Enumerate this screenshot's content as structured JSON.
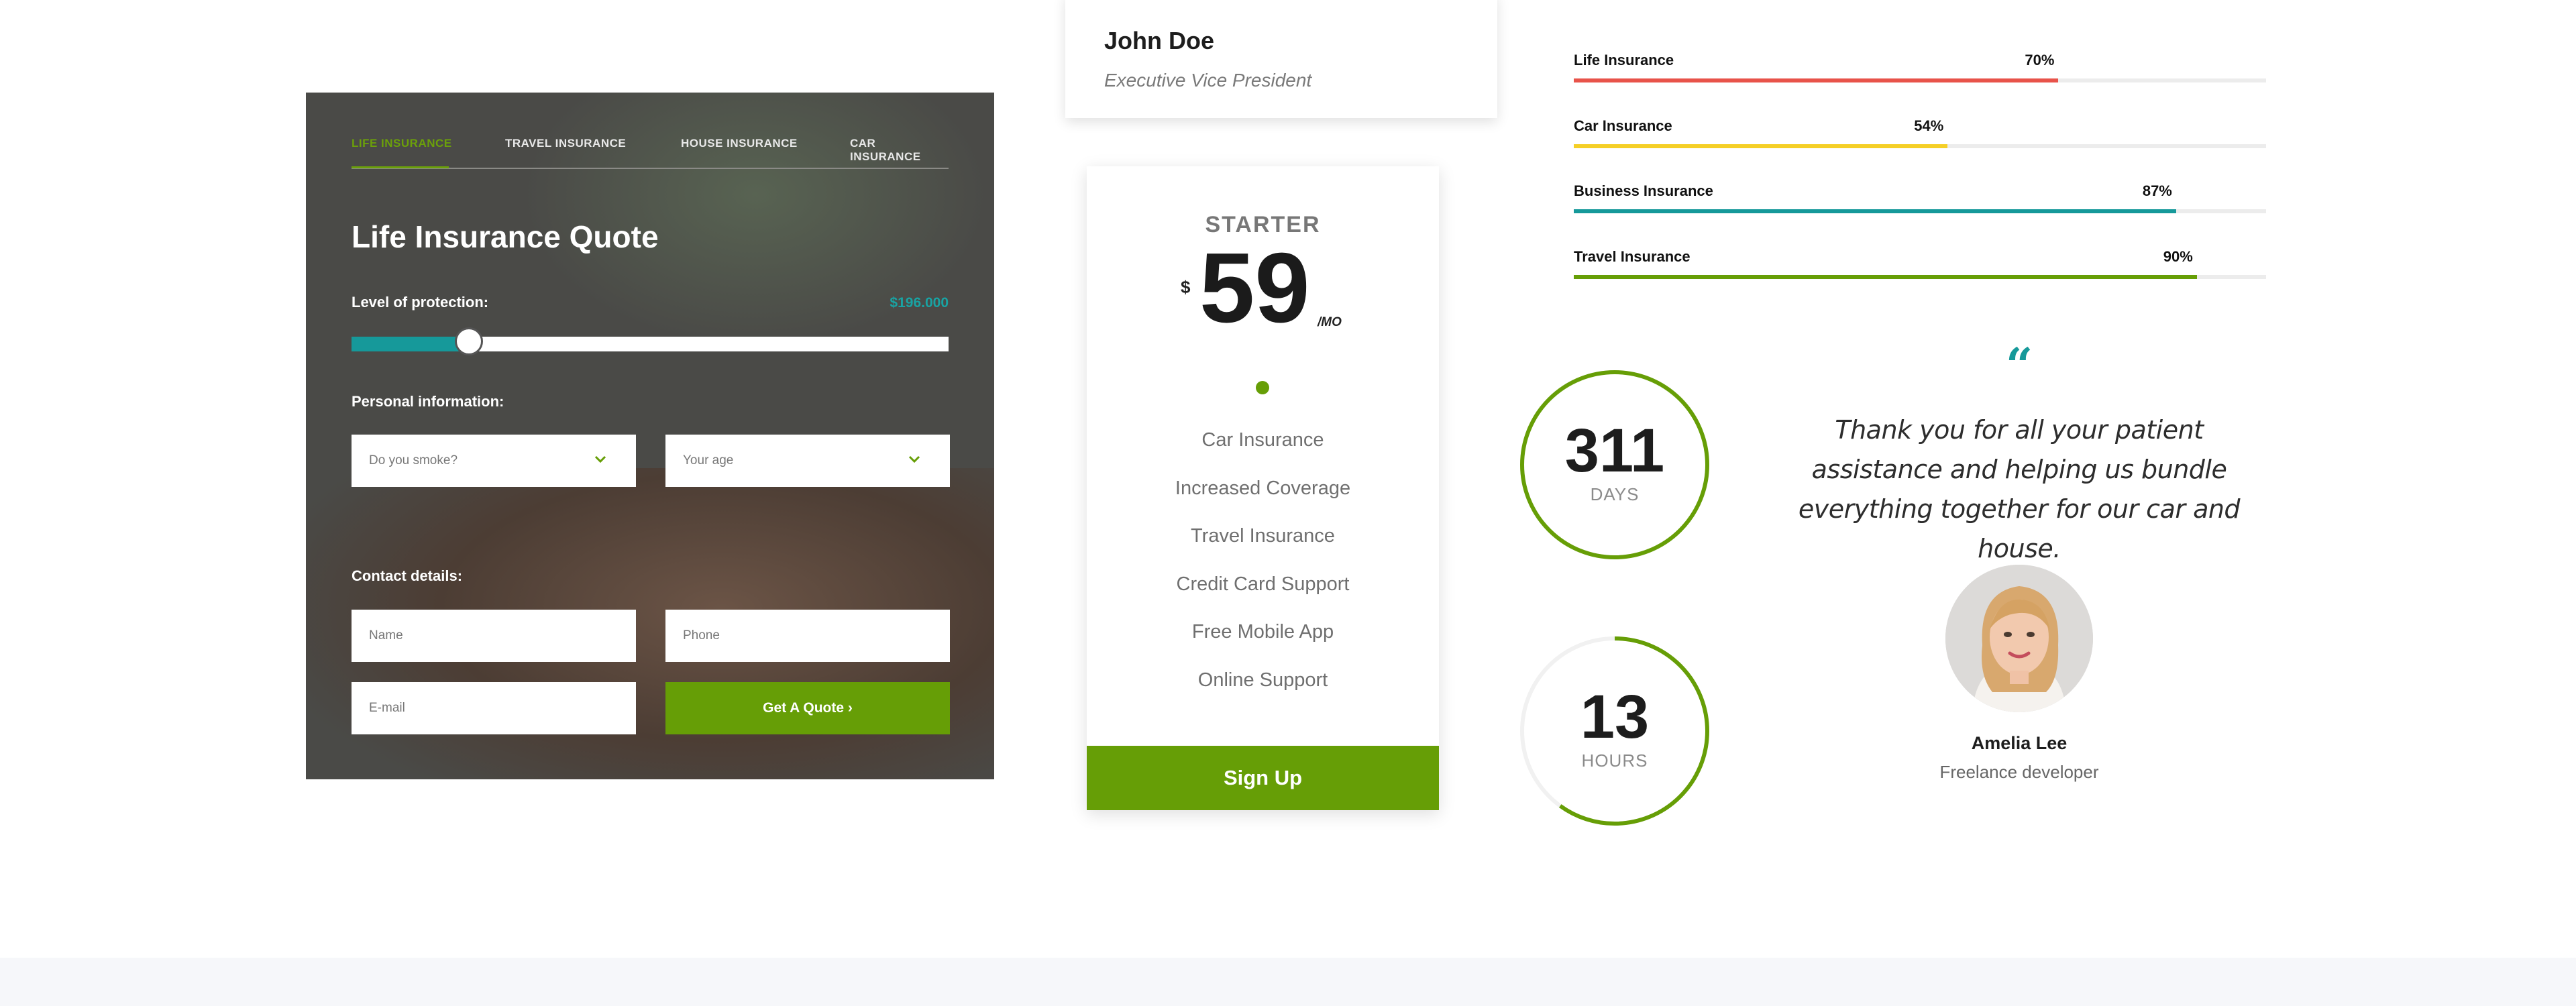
{
  "quote_form": {
    "tabs": [
      {
        "label": "LIFE INSURANCE",
        "active": true
      },
      {
        "label": "TRAVEL INSURANCE",
        "active": false
      },
      {
        "label": "HOUSE INSURANCE",
        "active": false
      },
      {
        "label": "CAR INSURANCE",
        "active": false
      }
    ],
    "title": "Life Insurance Quote",
    "protection_label": "Level of protection:",
    "protection_value": "$196.000",
    "protection_level_fraction": 0.2,
    "personal_label": "Personal information:",
    "smoke_select": "Do you smoke?",
    "age_select": "Your age",
    "contact_label": "Contact details:",
    "name_placeholder": "Name",
    "phone_placeholder": "Phone",
    "email_placeholder": "E-mail",
    "button_label": "Get A Quote ›",
    "accent_color": "#669e06",
    "teal_color": "#16999a"
  },
  "profile": {
    "name": "John Doe",
    "role": "Executive Vice President"
  },
  "pricing": {
    "plan": "STARTER",
    "currency": "$",
    "price": "59",
    "period": "/MO",
    "features": [
      "Car Insurance",
      "Increased Coverage",
      "Travel Insurance",
      "Credit Card Support",
      "Free Mobile App",
      "Online Support"
    ],
    "button_label": "Sign Up"
  },
  "progress_bars": [
    {
      "label": "Life Insurance",
      "percent_text": "70%",
      "value": 70,
      "color": "#e8534a"
    },
    {
      "label": "Car Insurance",
      "percent_text": "54%",
      "value": 54,
      "color": "#f5cf26"
    },
    {
      "label": "Business Insurance",
      "percent_text": "87%",
      "value": 87,
      "color": "#16999a"
    },
    {
      "label": "Travel Insurance",
      "percent_text": "90%",
      "value": 90,
      "color": "#669e06"
    }
  ],
  "counters": [
    {
      "value": "311",
      "label": "DAYS",
      "ring_fraction": 1.0
    },
    {
      "value": "13",
      "label": "HOURS",
      "ring_fraction": 0.6
    }
  ],
  "testimonial": {
    "quote_mark": "“",
    "text": "Thank you for all your patient assistance and helping us bundle everything together for our car and house.",
    "name": "Amelia Lee",
    "role": "Freelance developer"
  }
}
